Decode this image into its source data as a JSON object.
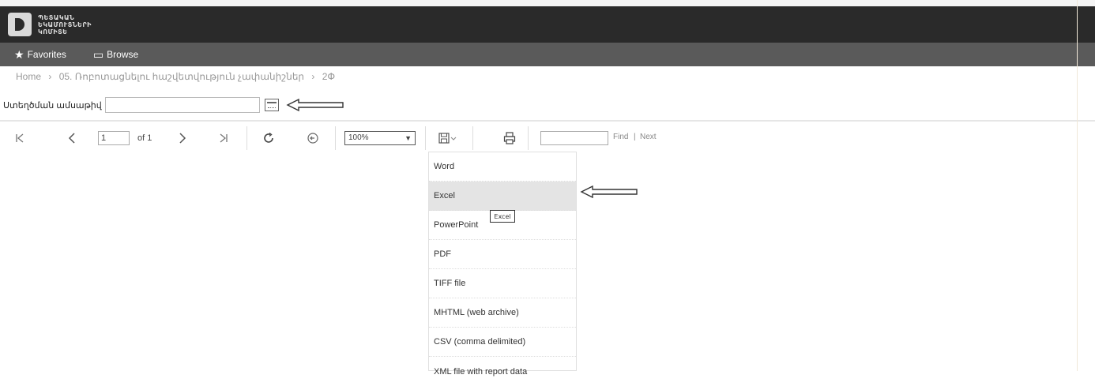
{
  "header": {
    "logo_text": "ՊԵՏԱԿԱՆ\nԵԿԱՄՈՒՏՆԵՐԻ\nԿՈՄԻՏԵ"
  },
  "nav": {
    "favorites_label": "Favorites",
    "browse_label": "Browse"
  },
  "breadcrumb": {
    "home": "Home",
    "sep": "›",
    "folder": "05. Ռոբոտացնելու հաշվետվություն չափանիշներ",
    "report": "2Փ"
  },
  "parameters": {
    "label": "Ստեղծման ամսաթիվ",
    "value": ""
  },
  "toolbar": {
    "page_value": "1",
    "of_label": "of 1",
    "zoom_value": "100%",
    "find_label": "Find",
    "next_label": "Next",
    "find_sep": "|"
  },
  "export_menu": {
    "items": [
      "Word",
      "Excel",
      "PowerPoint",
      "PDF",
      "TIFF file",
      "MHTML (web archive)",
      "CSV (comma delimited)",
      "XML file with report data"
    ],
    "hovered": "Excel",
    "tooltip": "Excel"
  },
  "icons": {
    "first_page": "first-page-icon",
    "prev_page": "prev-page-icon",
    "next_page": "next-page-icon",
    "last_page": "last-page-icon",
    "refresh": "refresh-icon",
    "back": "back-icon",
    "save": "save-icon",
    "print": "print-icon",
    "calendar": "calendar-icon"
  }
}
